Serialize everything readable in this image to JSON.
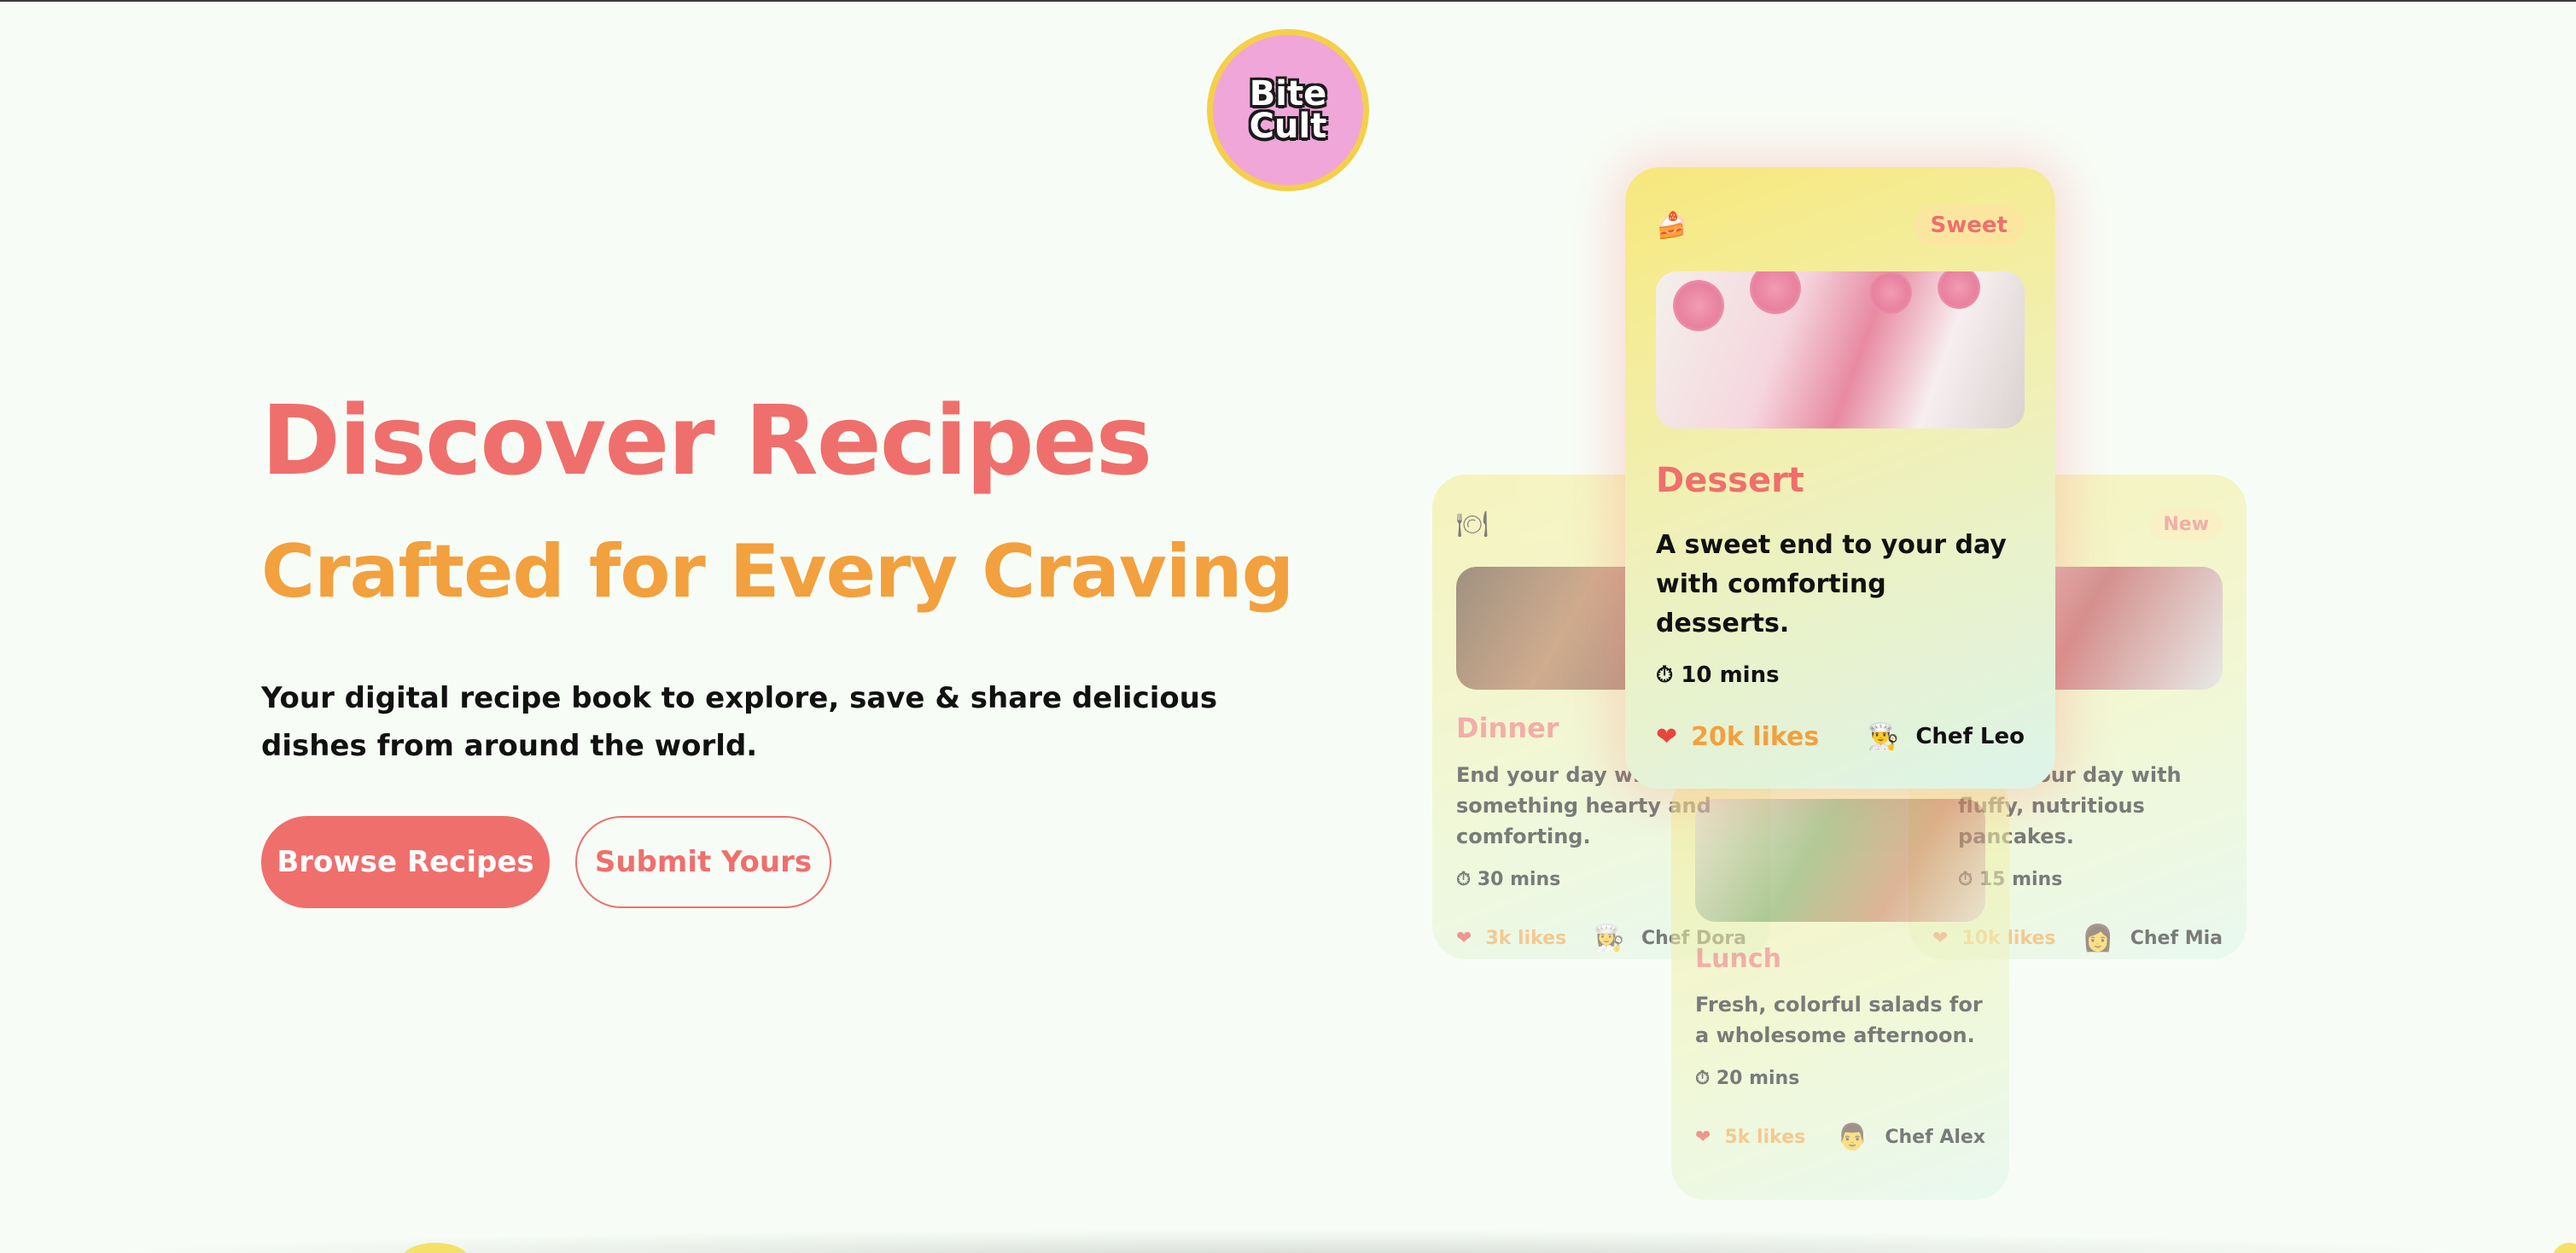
{
  "brand": {
    "logo_line1": "Bite",
    "logo_line2": "Cult"
  },
  "hero": {
    "title": "Discover Recipes",
    "subtitle": "Crafted for Every Craving",
    "description": "Your digital recipe book to explore, save & share delicious dishes from around the world.",
    "browse_button": "Browse Recipes",
    "submit_button": "Submit Yours"
  },
  "cards": {
    "dessert": {
      "emoji": "🍰",
      "tag": "Sweet",
      "title": "Dessert",
      "description": "A sweet end to your day with comforting desserts.",
      "time": "⏱ 10 mins",
      "likes": "20k likes",
      "chef": "Chef Leo",
      "chef_emoji": "👨‍🍳"
    },
    "dinner": {
      "emoji": "🍽",
      "title": "Dinner",
      "description": "End your day with something hearty and comforting.",
      "time": "⏱ 30 mins",
      "likes": "3k likes",
      "chef": "Chef Dora",
      "chef_emoji": "👩‍🍳"
    },
    "breakfast": {
      "tag": "New",
      "description": "Start your day with fluffy, nutritious pancakes.",
      "time": "⏱ 15 mins",
      "likes": "10k likes",
      "chef": "Chef Mia",
      "chef_emoji": "👩"
    },
    "lunch": {
      "title": "Lunch",
      "description": "Fresh, colorful salads for a wholesome afternoon.",
      "time": "⏱ 20 mins",
      "likes": "5k likes",
      "chef": "Chef Alex",
      "chef_emoji": "👨"
    }
  },
  "colors": {
    "primary": "#ef6f6c",
    "accent": "#f3a03e",
    "background": "#f7fdf6",
    "logo_bg": "#f0a6d8",
    "logo_ring": "#f5cf4a"
  },
  "icons": {
    "heart": "❤"
  }
}
